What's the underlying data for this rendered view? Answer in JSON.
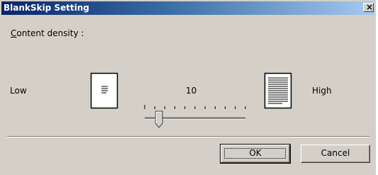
{
  "window": {
    "title": "BlankSkip Setting",
    "close_glyph": "×"
  },
  "content": {
    "density_label_prefix": "C",
    "density_label_rest": "ontent density :",
    "low_label": "Low",
    "high_label": "High",
    "value": "10",
    "slider_value_fraction": 0.1
  },
  "buttons": {
    "ok": "OK",
    "cancel": "Cancel"
  },
  "icons": {
    "low": "document-low-density-icon",
    "high": "document-high-density-icon"
  },
  "colors": {
    "title_start": "#0a246a",
    "title_end": "#a6caf0",
    "face": "#d4d0c8"
  }
}
